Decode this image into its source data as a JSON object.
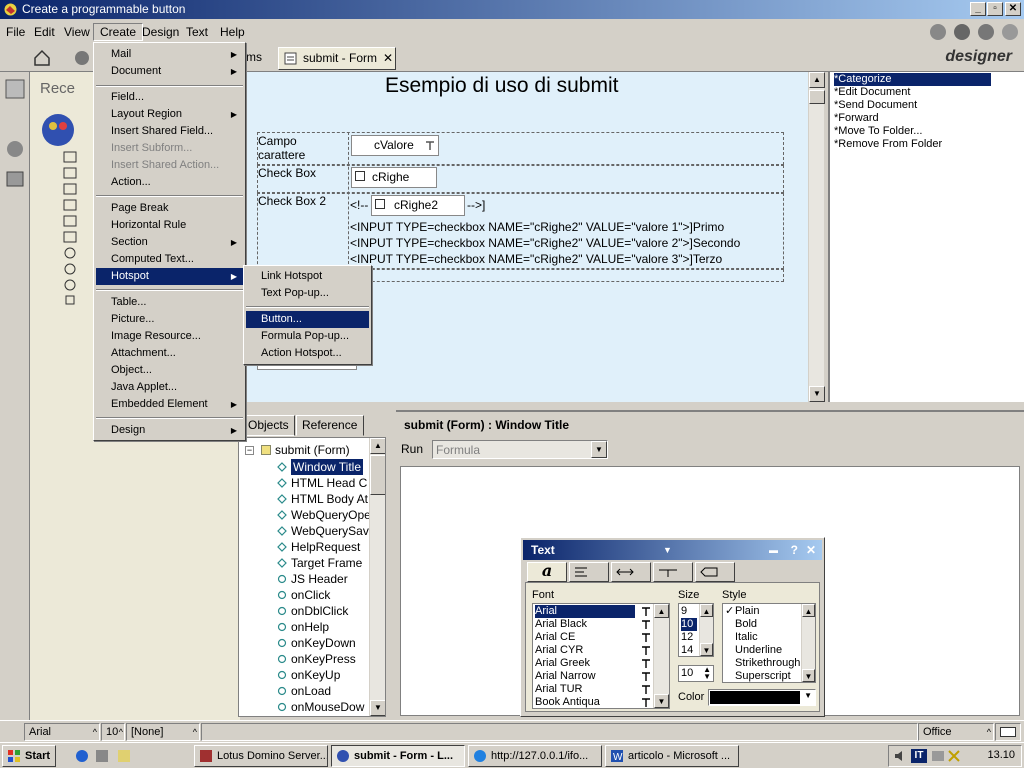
{
  "window": {
    "title": "Create a programmable button",
    "min": "_",
    "max": "▫",
    "close": "✕"
  },
  "menubar": [
    "File",
    "Edit",
    "View",
    "Create",
    "Design",
    "Text",
    "Help"
  ],
  "tabs": {
    "partial": "ms",
    "active": "submit - Form",
    "close": "✕",
    "designer": "designer"
  },
  "recent_label": "Rece",
  "canvas": {
    "title": "Esempio di uso di submit",
    "row1_label": "Campo\ncarattere",
    "row1_field": "cValore",
    "row2_label": "Check Box",
    "row2_field": "cRighe",
    "row3_label": "Check Box 2",
    "row3_open": "<!--",
    "row3_field": "cRighe2",
    "row3_close": "-->]",
    "html_lines": [
      "<INPUT TYPE=checkbox NAME=\"cRighe2\" VALUE=\"valore 1\">]Primo",
      "<INPUT TYPE=checkbox NAME=\"cRighe2\" VALUE=\"valore 2\">]Secondo",
      "<INPUT TYPE=checkbox NAME=\"cRighe2\" VALUE=\"valore 3\">]Terzo"
    ]
  },
  "actions": [
    "*Categorize",
    "*Edit Document",
    "*Send Document",
    "*Forward",
    "*Move To Folder...",
    "*Remove From Folder"
  ],
  "create_menu": [
    {
      "label": "Mail",
      "sub": true
    },
    {
      "label": "Document",
      "sub": true
    },
    {
      "sep": true
    },
    {
      "label": "Field..."
    },
    {
      "label": "Layout Region",
      "sub": true
    },
    {
      "label": "Insert Shared Field..."
    },
    {
      "label": "Insert Subform...",
      "disabled": true
    },
    {
      "label": "Insert Shared Action...",
      "disabled": true
    },
    {
      "label": "Action..."
    },
    {
      "sep": true
    },
    {
      "label": "Page Break"
    },
    {
      "label": "Horizontal Rule"
    },
    {
      "label": "Section",
      "sub": true
    },
    {
      "label": "Computed Text..."
    },
    {
      "label": "Hotspot",
      "sub": true,
      "highlight": true
    },
    {
      "sep": true
    },
    {
      "label": "Table..."
    },
    {
      "label": "Picture..."
    },
    {
      "label": "Image Resource..."
    },
    {
      "label": "Attachment..."
    },
    {
      "label": "Object..."
    },
    {
      "label": "Java Applet..."
    },
    {
      "label": "Embedded Element",
      "sub": true
    },
    {
      "sep": true
    },
    {
      "label": "Design",
      "sub": true
    }
  ],
  "hotspot_menu": [
    {
      "label": "Link Hotspot"
    },
    {
      "label": "Text Pop-up..."
    },
    {
      "sep": true
    },
    {
      "label": "Button...",
      "highlight": true
    },
    {
      "label": "Formula Pop-up..."
    },
    {
      "label": "Action Hotspot..."
    }
  ],
  "objects_tabs": [
    "Objects",
    "Reference"
  ],
  "tree": {
    "root": "submit (Form)",
    "items": [
      "Window Title",
      "HTML Head C",
      "HTML Body At",
      "WebQueryOpe",
      "WebQuerySav",
      "HelpRequest",
      "Target Frame",
      "JS Header",
      "onClick",
      "onDblClick",
      "onHelp",
      "onKeyDown",
      "onKeyPress",
      "onKeyUp",
      "onLoad",
      "onMouseDow"
    ]
  },
  "script": {
    "header": "submit (Form) : Window Title",
    "run_label": "Run",
    "run_value": "Formula"
  },
  "text_props": {
    "title": "Text",
    "font_label": "Font",
    "fonts": [
      "Arial",
      "Arial Black",
      "Arial CE",
      "Arial CYR",
      "Arial Greek",
      "Arial Narrow",
      "Arial TUR",
      "Book Antiqua"
    ],
    "size_label": "Size",
    "sizes": [
      "9",
      "10",
      "12",
      "14"
    ],
    "size_value": "10",
    "style_label": "Style",
    "styles": [
      "Plain",
      "Bold",
      "Italic",
      "Underline",
      "Strikethrough",
      "Superscript"
    ],
    "color_label": "Color",
    "color_value": "#000000",
    "tab_a": "a"
  },
  "statusbar": {
    "font": "Arial",
    "size": "10",
    "style": "[None]",
    "office": "Office"
  },
  "taskbar": {
    "start": "Start",
    "buttons": [
      "Lotus Domino Server...",
      "submit - Form - L...",
      "http://127.0.0.1/ifo...",
      "articolo - Microsoft ..."
    ],
    "tray_lang": "IT",
    "clock": "13.10"
  },
  "accent": "#0a246a"
}
